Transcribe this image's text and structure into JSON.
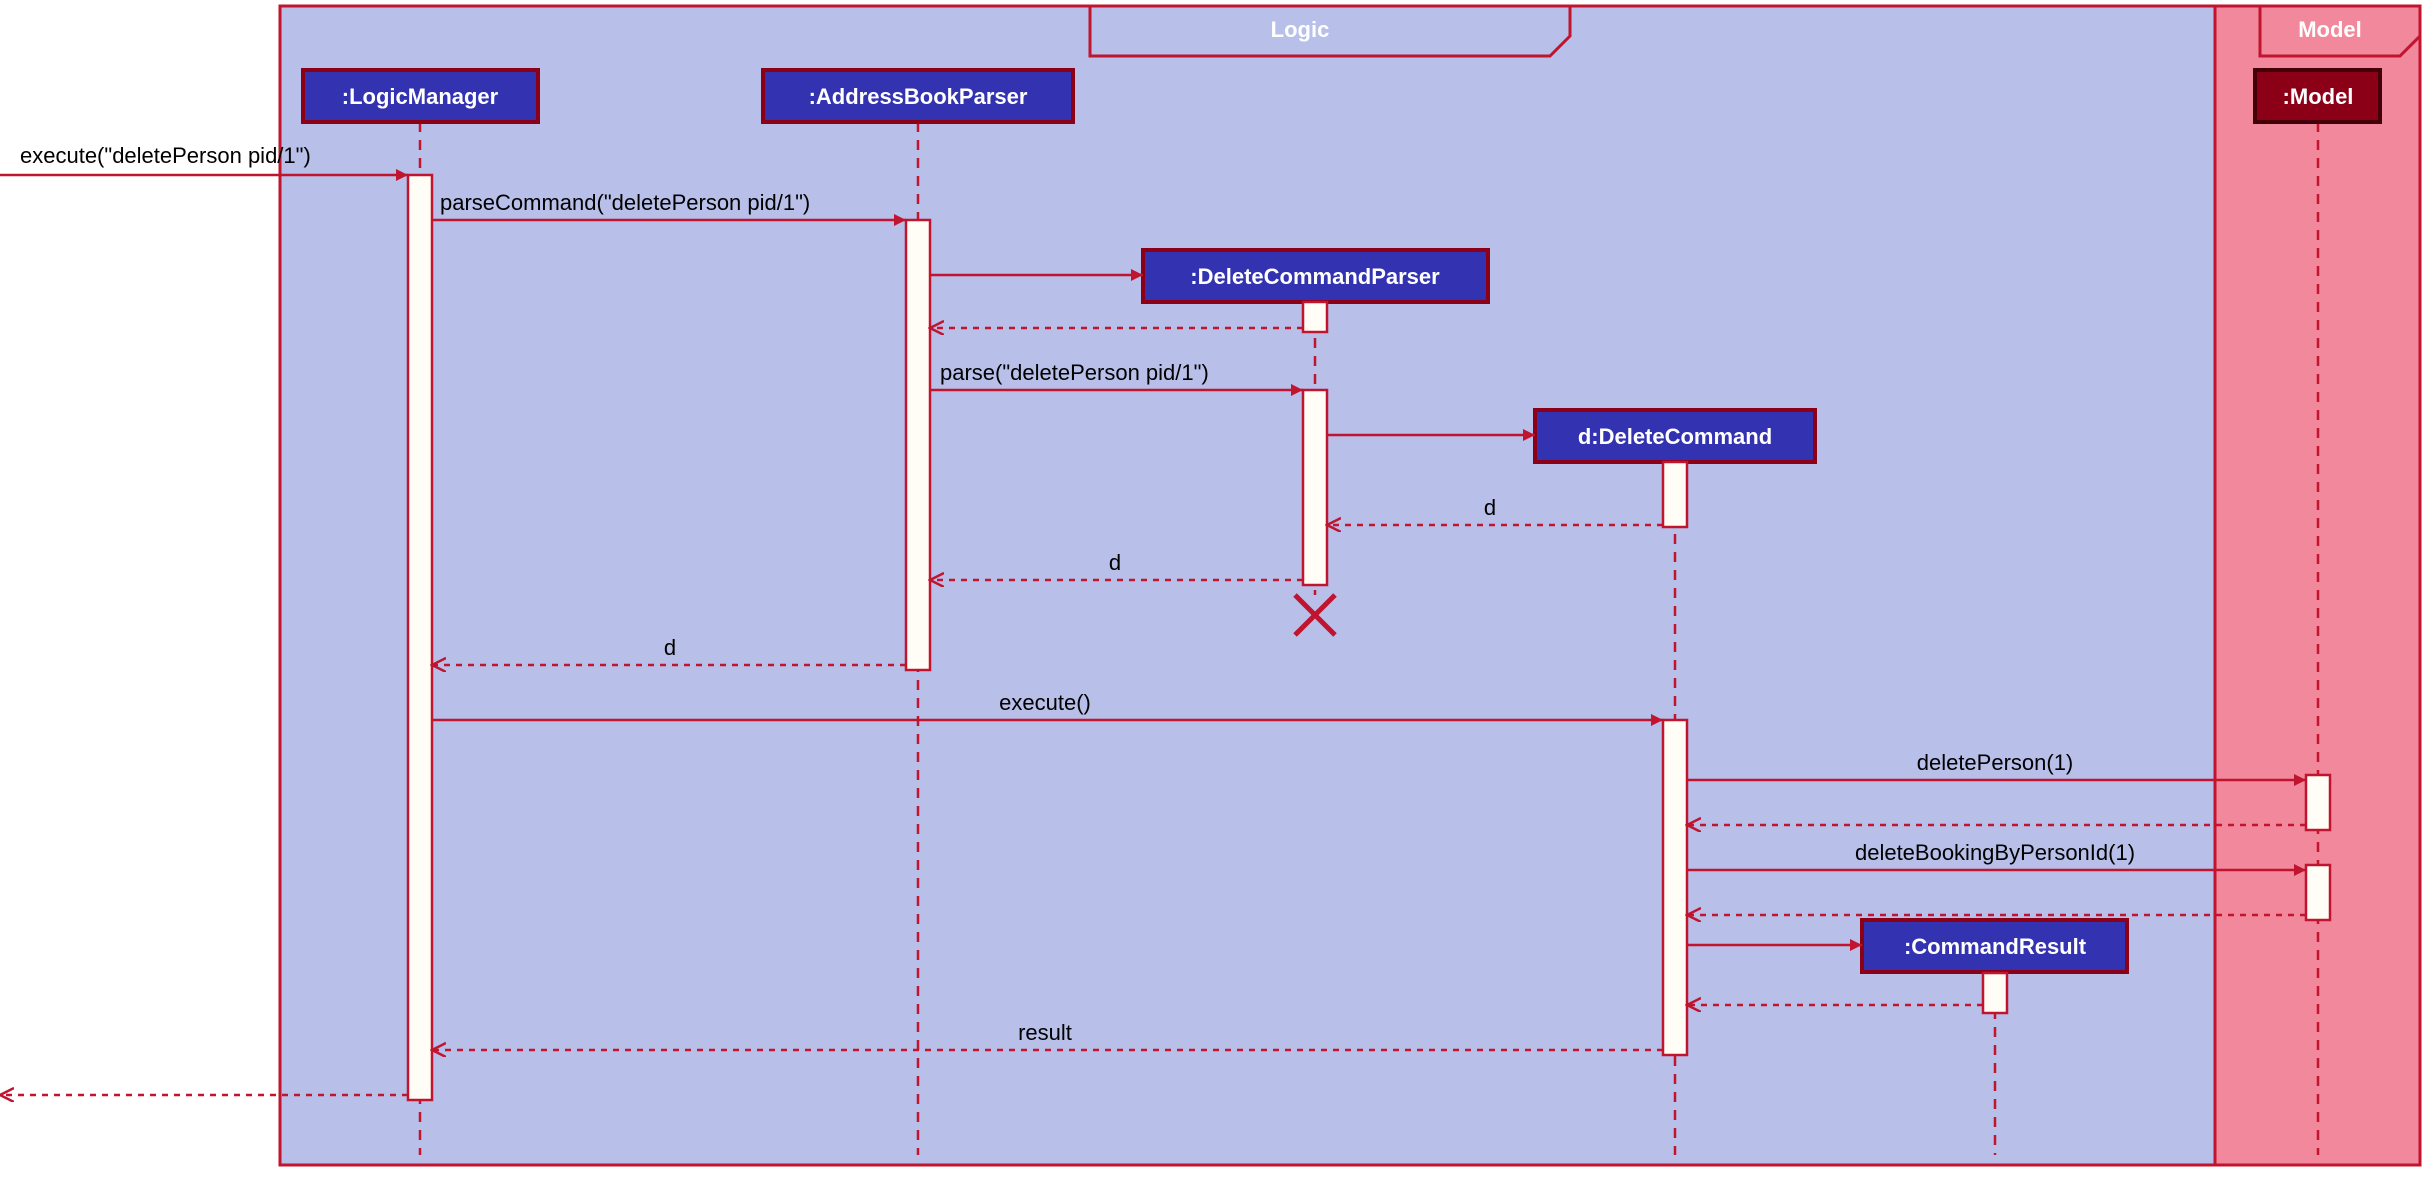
{
  "diagram": {
    "frames": {
      "logic": {
        "label": "Logic"
      },
      "model": {
        "label": "Model"
      }
    },
    "participants": {
      "logicManager": {
        "label": ":LogicManager"
      },
      "addressBookParser": {
        "label": ":AddressBookParser"
      },
      "deleteCmdParser": {
        "label": ":DeleteCommandParser"
      },
      "deleteCommand": {
        "label": "d:DeleteCommand"
      },
      "commandResult": {
        "label": ":CommandResult"
      },
      "model": {
        "label": ":Model"
      }
    },
    "messages": {
      "m1": "execute(\"deletePerson pid/1\")",
      "m2": "parseCommand(\"deletePerson pid/1\")",
      "m3": "parse(\"deletePerson pid/1\")",
      "m4": "d",
      "m5": "d",
      "m6": "d",
      "m7": "execute()",
      "m8": "deletePerson(1)",
      "m9": "deleteBookingByPersonId(1)",
      "m10": "result"
    }
  }
}
